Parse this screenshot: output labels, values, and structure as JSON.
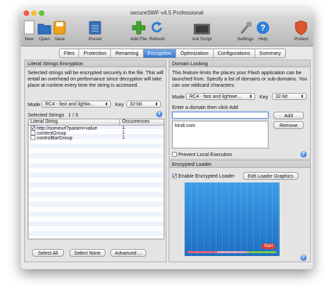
{
  "window": {
    "title": "secureSWF v4.5 Professional"
  },
  "toolbar": {
    "items": [
      {
        "label": "New",
        "icon": "new-document-icon"
      },
      {
        "label": "Open",
        "icon": "folder-icon"
      },
      {
        "label": "Save",
        "icon": "save-disk-icon"
      },
      {
        "label": "Preset",
        "icon": "preset-icon"
      },
      {
        "label": "Add File",
        "icon": "add-plus-icon"
      },
      {
        "label": "Refresh",
        "icon": "refresh-icon"
      },
      {
        "label": "Ant Script",
        "icon": "ant-script-icon"
      },
      {
        "label": "Settings",
        "icon": "settings-icon"
      },
      {
        "label": "Help",
        "icon": "help-icon"
      },
      {
        "label": "Protect",
        "icon": "protect-shield-icon"
      }
    ]
  },
  "tabs": [
    "Files",
    "Protection",
    "Renaming",
    "Encryption",
    "Optimization",
    "Configurations",
    "Summary"
  ],
  "active_tab": "Encryption",
  "literal": {
    "header": "Literal Strings Encryption",
    "description": "Selected strings will be encrypted securely in the file. This will entail an overhead on performance since decryption will take place at runtime every time the string is accessed.",
    "mode_label": "Mode",
    "mode_value": "RC4 - fast and lightw...",
    "key_label": "Key",
    "key_value": "32-bit",
    "selected_label": "Selected Strings",
    "selected_count": "1 / 3",
    "col_string": "Literal String",
    "col_occ": "Occurrences",
    "rows": [
      {
        "string": "http://someurl?param=value",
        "occ": "1",
        "checked": true
      },
      {
        "string": "contentGroup",
        "occ": "1",
        "checked": false
      },
      {
        "string": "controlBarGroup",
        "occ": "1",
        "checked": false
      }
    ],
    "btn_select_all": "Select All",
    "btn_select_none": "Select None",
    "btn_advanced": "Advanced ..."
  },
  "domain": {
    "header": "Domain Locking",
    "description": "This feature limits the places your Flash application can be launched from. Specify a list of domains or sub-domains. You can use wildcard characters.",
    "mode_label": "Mode",
    "mode_value": "RC4 - fast and lightwe...",
    "key_label": "Key",
    "key_value": "32-bit",
    "enter_label": "Enter a domain then click Add",
    "input_value": "",
    "btn_add": "Add",
    "btn_remove": "Remove",
    "domains": [
      "kindi.com"
    ],
    "prevent_label": "Prevent Local Execution"
  },
  "loader": {
    "header": "Encrypted Loader",
    "enable_label": "Enable Encrypted Loader",
    "btn_edit": "Edit Loader Graphics",
    "start_label": "Start"
  },
  "colors": {
    "accent": "#3a79d2",
    "loader_bg": "#2a86d8",
    "start": "#e53b2c"
  }
}
